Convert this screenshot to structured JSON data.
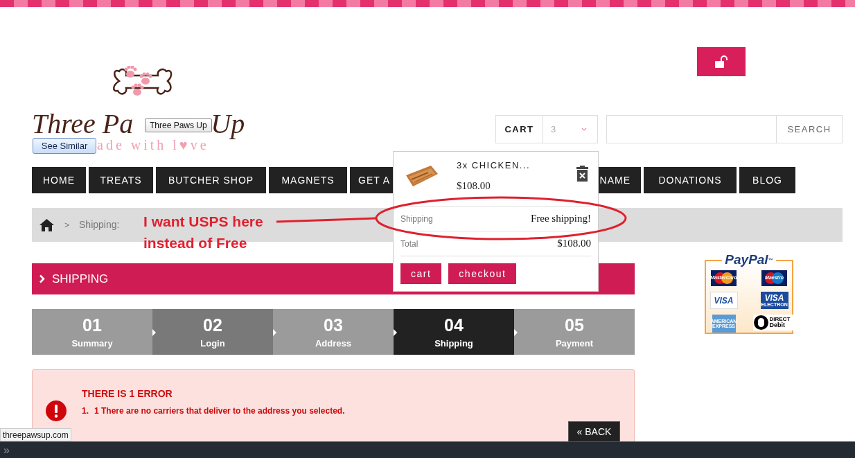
{
  "logo": {
    "title_left": "Three Pa",
    "title_right": "Up",
    "tagline": "ade with l♥ve"
  },
  "tooltips": {
    "logo_tooltip": "Three Paws Up",
    "see_similar": "See Similar"
  },
  "header": {
    "cart_label": "CART",
    "cart_count": "3",
    "search_button": "SEARCH"
  },
  "nav": [
    {
      "label": "HOME"
    },
    {
      "label": "TREATS"
    },
    {
      "label": "BUTCHER SHOP"
    },
    {
      "label": "MAGNETS"
    },
    {
      "label": "GET A"
    },
    {
      "label": "NAME"
    },
    {
      "label": "DONATIONS"
    },
    {
      "label": "BLOG"
    }
  ],
  "breadcrumb": {
    "separator": ">",
    "current": "Shipping:"
  },
  "annotation": {
    "lines": [
      "I want USPS here",
      "instead of Free"
    ]
  },
  "cart_dropdown": {
    "item_name": "3x CHICKEN...",
    "item_price": "$108.00",
    "shipping_label": "Shipping",
    "shipping_value": "Free shipping!",
    "total_label": "Total",
    "total_value": "$108.00",
    "buttons": [
      "cart",
      "checkout"
    ]
  },
  "section_title": "SHIPPING",
  "steps": [
    {
      "number": "01",
      "label": "Summary",
      "selected": false,
      "highlighted": false
    },
    {
      "number": "02",
      "label": "Login",
      "selected": false,
      "highlighted": true
    },
    {
      "number": "03",
      "label": "Address",
      "selected": false,
      "highlighted": false
    },
    {
      "number": "04",
      "label": "Shipping",
      "selected": true,
      "highlighted": false
    },
    {
      "number": "05",
      "label": "Payment",
      "selected": false,
      "highlighted": false
    }
  ],
  "error": {
    "title": "THERE IS 1 ERROR",
    "items": [
      {
        "number": "1.",
        "text": "1 There are no carriers that deliver to the address you selected."
      }
    ],
    "back_button": "« BACK"
  },
  "paypal": {
    "title": "PayPal",
    "trademark": "™",
    "cards": [
      {
        "kind": "mastercard",
        "label": "MasterCard"
      },
      {
        "kind": "maestro",
        "label": "Maestro"
      },
      {
        "kind": "visa",
        "label": "VISA"
      },
      {
        "kind": "visa_electron",
        "label": "VISA",
        "sub": "ELECTRON"
      },
      {
        "kind": "amex",
        "label": "AMERICAN EXPRESS"
      },
      {
        "kind": "direct_debit",
        "label": "DIRECT",
        "sub": "Debit"
      }
    ]
  },
  "status_link": "threepawsup.com",
  "bottom_bar": {
    "icon": "»"
  }
}
